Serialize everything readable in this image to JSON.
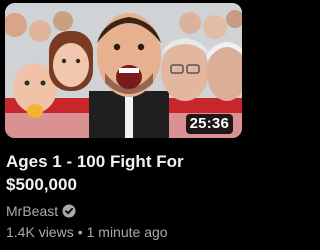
{
  "video": {
    "duration": "25:36",
    "title": "Ages 1 - 100 Fight For $500,000",
    "channel": "MrBeast",
    "views": "1.4K views",
    "separator": "•",
    "age": "1 minute ago"
  },
  "icons": {
    "verified": "verified-check-icon"
  },
  "colors": {
    "background": "#000000",
    "title": "#f1f1f1",
    "meta": "#aaaaaa",
    "duration_bg": "#000000"
  }
}
